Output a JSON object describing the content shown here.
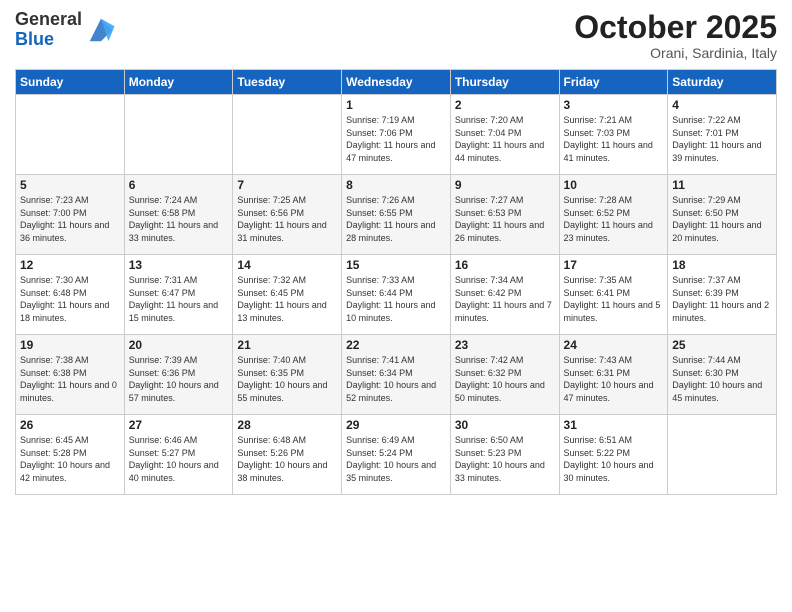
{
  "logo": {
    "general": "General",
    "blue": "Blue"
  },
  "title": "October 2025",
  "location": "Orani, Sardinia, Italy",
  "days_of_week": [
    "Sunday",
    "Monday",
    "Tuesday",
    "Wednesday",
    "Thursday",
    "Friday",
    "Saturday"
  ],
  "weeks": [
    [
      {
        "day": "",
        "info": ""
      },
      {
        "day": "",
        "info": ""
      },
      {
        "day": "",
        "info": ""
      },
      {
        "day": "1",
        "info": "Sunrise: 7:19 AM\nSunset: 7:06 PM\nDaylight: 11 hours and 47 minutes."
      },
      {
        "day": "2",
        "info": "Sunrise: 7:20 AM\nSunset: 7:04 PM\nDaylight: 11 hours and 44 minutes."
      },
      {
        "day": "3",
        "info": "Sunrise: 7:21 AM\nSunset: 7:03 PM\nDaylight: 11 hours and 41 minutes."
      },
      {
        "day": "4",
        "info": "Sunrise: 7:22 AM\nSunset: 7:01 PM\nDaylight: 11 hours and 39 minutes."
      }
    ],
    [
      {
        "day": "5",
        "info": "Sunrise: 7:23 AM\nSunset: 7:00 PM\nDaylight: 11 hours and 36 minutes."
      },
      {
        "day": "6",
        "info": "Sunrise: 7:24 AM\nSunset: 6:58 PM\nDaylight: 11 hours and 33 minutes."
      },
      {
        "day": "7",
        "info": "Sunrise: 7:25 AM\nSunset: 6:56 PM\nDaylight: 11 hours and 31 minutes."
      },
      {
        "day": "8",
        "info": "Sunrise: 7:26 AM\nSunset: 6:55 PM\nDaylight: 11 hours and 28 minutes."
      },
      {
        "day": "9",
        "info": "Sunrise: 7:27 AM\nSunset: 6:53 PM\nDaylight: 11 hours and 26 minutes."
      },
      {
        "day": "10",
        "info": "Sunrise: 7:28 AM\nSunset: 6:52 PM\nDaylight: 11 hours and 23 minutes."
      },
      {
        "day": "11",
        "info": "Sunrise: 7:29 AM\nSunset: 6:50 PM\nDaylight: 11 hours and 20 minutes."
      }
    ],
    [
      {
        "day": "12",
        "info": "Sunrise: 7:30 AM\nSunset: 6:48 PM\nDaylight: 11 hours and 18 minutes."
      },
      {
        "day": "13",
        "info": "Sunrise: 7:31 AM\nSunset: 6:47 PM\nDaylight: 11 hours and 15 minutes."
      },
      {
        "day": "14",
        "info": "Sunrise: 7:32 AM\nSunset: 6:45 PM\nDaylight: 11 hours and 13 minutes."
      },
      {
        "day": "15",
        "info": "Sunrise: 7:33 AM\nSunset: 6:44 PM\nDaylight: 11 hours and 10 minutes."
      },
      {
        "day": "16",
        "info": "Sunrise: 7:34 AM\nSunset: 6:42 PM\nDaylight: 11 hours and 7 minutes."
      },
      {
        "day": "17",
        "info": "Sunrise: 7:35 AM\nSunset: 6:41 PM\nDaylight: 11 hours and 5 minutes."
      },
      {
        "day": "18",
        "info": "Sunrise: 7:37 AM\nSunset: 6:39 PM\nDaylight: 11 hours and 2 minutes."
      }
    ],
    [
      {
        "day": "19",
        "info": "Sunrise: 7:38 AM\nSunset: 6:38 PM\nDaylight: 11 hours and 0 minutes."
      },
      {
        "day": "20",
        "info": "Sunrise: 7:39 AM\nSunset: 6:36 PM\nDaylight: 10 hours and 57 minutes."
      },
      {
        "day": "21",
        "info": "Sunrise: 7:40 AM\nSunset: 6:35 PM\nDaylight: 10 hours and 55 minutes."
      },
      {
        "day": "22",
        "info": "Sunrise: 7:41 AM\nSunset: 6:34 PM\nDaylight: 10 hours and 52 minutes."
      },
      {
        "day": "23",
        "info": "Sunrise: 7:42 AM\nSunset: 6:32 PM\nDaylight: 10 hours and 50 minutes."
      },
      {
        "day": "24",
        "info": "Sunrise: 7:43 AM\nSunset: 6:31 PM\nDaylight: 10 hours and 47 minutes."
      },
      {
        "day": "25",
        "info": "Sunrise: 7:44 AM\nSunset: 6:30 PM\nDaylight: 10 hours and 45 minutes."
      }
    ],
    [
      {
        "day": "26",
        "info": "Sunrise: 6:45 AM\nSunset: 5:28 PM\nDaylight: 10 hours and 42 minutes."
      },
      {
        "day": "27",
        "info": "Sunrise: 6:46 AM\nSunset: 5:27 PM\nDaylight: 10 hours and 40 minutes."
      },
      {
        "day": "28",
        "info": "Sunrise: 6:48 AM\nSunset: 5:26 PM\nDaylight: 10 hours and 38 minutes."
      },
      {
        "day": "29",
        "info": "Sunrise: 6:49 AM\nSunset: 5:24 PM\nDaylight: 10 hours and 35 minutes."
      },
      {
        "day": "30",
        "info": "Sunrise: 6:50 AM\nSunset: 5:23 PM\nDaylight: 10 hours and 33 minutes."
      },
      {
        "day": "31",
        "info": "Sunrise: 6:51 AM\nSunset: 5:22 PM\nDaylight: 10 hours and 30 minutes."
      },
      {
        "day": "",
        "info": ""
      }
    ]
  ]
}
